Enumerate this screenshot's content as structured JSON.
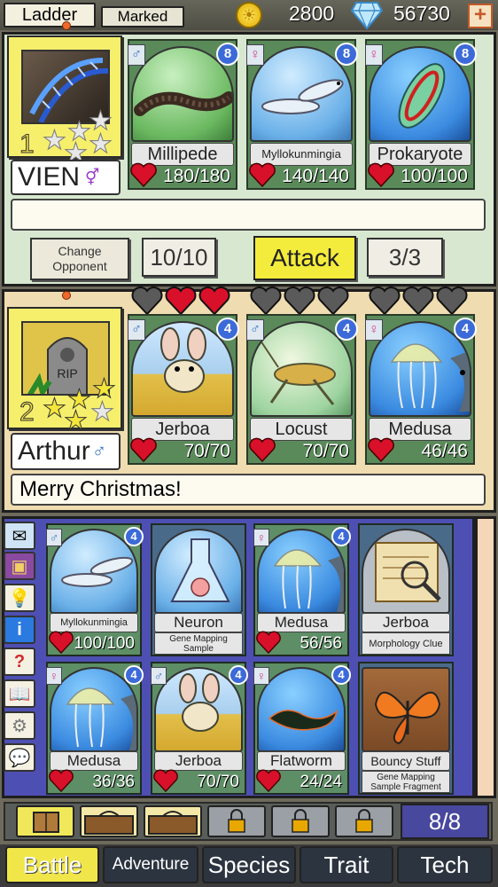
{
  "topbar": {
    "tabs": [
      "Ladder",
      "Marked"
    ],
    "coins": "2800",
    "gems": "56730",
    "plus": "+"
  },
  "opponent": {
    "rank": "1",
    "stars": 3,
    "name": "VIEN",
    "gender_symbol": "⚥",
    "message": "",
    "cards": [
      {
        "name": "Millipede",
        "gender": "♂",
        "level": "8",
        "hp": "180/180",
        "bg": "bg-mosaic"
      },
      {
        "name": "Myllokunmingia",
        "gender": "♀",
        "level": "8",
        "hp": "140/140",
        "bg": "bg-blue"
      },
      {
        "name": "Prokaryote",
        "gender": "♀",
        "level": "8",
        "hp": "100/100",
        "bg": "bg-deep"
      }
    ]
  },
  "controls": {
    "change_opponent": "Change\nOpponent",
    "tickets": "10/10",
    "attack": "Attack",
    "attacks_left": "3/3"
  },
  "player": {
    "rank": "2",
    "stars": 4,
    "name": "Arthur",
    "gender_symbol": "♂",
    "message": "Merry Christmas!",
    "cards": [
      {
        "name": "Jerboa",
        "gender": "♂",
        "level": "4",
        "hp": "70/70",
        "bg": "bg-sand",
        "lives": [
          0,
          1,
          1
        ]
      },
      {
        "name": "Locust",
        "gender": "♂",
        "level": "4",
        "hp": "70/70",
        "bg": "bg-green",
        "lives": [
          0,
          0,
          0
        ]
      },
      {
        "name": "Medusa",
        "gender": "♀",
        "level": "4",
        "hp": "46/46",
        "bg": "bg-deep",
        "lives": [
          0,
          0,
          0
        ]
      }
    ]
  },
  "inventory": {
    "cards": [
      {
        "name": "Myllokunmingia",
        "gender": "♂",
        "level": "4",
        "hp": "100/100",
        "bg": "bg-blue",
        "small": true
      },
      {
        "name": "Neuron",
        "sub": "Gene Mapping Sample",
        "bg": "bg-blue"
      },
      {
        "name": "Medusa",
        "gender": "♀",
        "level": "4",
        "hp": "56/56",
        "bg": "bg-deep"
      },
      {
        "name": "Jerboa",
        "sub": "Morphology Clue",
        "bg": "bg-grey"
      },
      {
        "name": "Medusa",
        "gender": "♀",
        "level": "4",
        "hp": "36/36",
        "bg": "bg-deep"
      },
      {
        "name": "Jerboa",
        "gender": "♂",
        "level": "4",
        "hp": "70/70",
        "bg": "bg-sand"
      },
      {
        "name": "Flatworm",
        "gender": "♀",
        "level": "4",
        "hp": "24/24",
        "bg": "bg-deep"
      },
      {
        "name": "Bouncy Stuff",
        "sub": "Gene Mapping Sample Fragment",
        "bg": "bg-wood"
      }
    ],
    "side_icons": [
      "mail-icon",
      "chest-icon",
      "lightbulb-icon",
      "info-icon",
      "help-icon",
      "book-icon",
      "gear-icon",
      "chat-icon"
    ]
  },
  "slots": {
    "count": "8/8"
  },
  "nav": {
    "tabs": [
      "Battle",
      "Adventure",
      "Species",
      "Trait",
      "Tech"
    ]
  }
}
